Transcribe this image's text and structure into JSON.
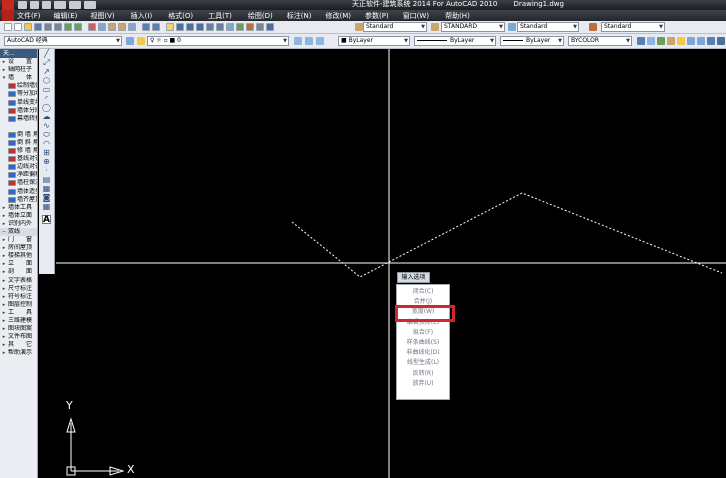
{
  "title_bar": {
    "title": "天正软件-建筑系统 2014  For AutoCAD 2010",
    "document": "Drawing1.dwg"
  },
  "menu_bar": {
    "items": [
      "文件(F)",
      "编辑(E)",
      "视图(V)",
      "插入(I)",
      "格式(O)",
      "工具(T)",
      "绘图(D)",
      "标注(N)",
      "修改(M)",
      "参数(P)",
      "窗口(W)",
      "帮助(H)"
    ]
  },
  "toolbar1": {
    "text_style": "Standard",
    "dim_style": "STANDARD",
    "table_style": "Standard",
    "multileader_style": "Standard"
  },
  "toolbar2": {
    "workspace": "AutoCAD 经典",
    "layer": "0",
    "color": "ByLayer",
    "linetype": "ByLayer",
    "lineweight": "ByLayer",
    "plot_style": "BYCOLOR"
  },
  "palette": {
    "title": "天...",
    "items": [
      {
        "marker": "▸",
        "label": "设　　置",
        "color": "#ffffff"
      },
      {
        "marker": "▸",
        "label": "轴网柱子",
        "color": "#ffffff"
      },
      {
        "marker": "▾",
        "label": "墙　　体",
        "color": "#ffffff"
      },
      {
        "marker": "",
        "label": "绘制墙体",
        "color": "#c62f2f"
      },
      {
        "marker": "",
        "label": "等分加墙",
        "color": "#2f6ac6"
      },
      {
        "marker": "",
        "label": "单线变墙",
        "color": "#2f6ac6"
      },
      {
        "marker": "",
        "label": "墙体分段",
        "color": "#c62f2f"
      },
      {
        "marker": "",
        "label": "幕墙转换",
        "color": "#2f6ac6"
      },
      {
        "marker": "",
        "label": "",
        "color": "#ffffff"
      },
      {
        "marker": "",
        "label": "倒 墙 角",
        "color": "#2f6ac6"
      },
      {
        "marker": "",
        "label": "倒 斜 角",
        "color": "#2f6ac6"
      },
      {
        "marker": "",
        "label": "修 墙 角",
        "color": "#c62f2f"
      },
      {
        "marker": "",
        "label": "基线对齐",
        "color": "#c62f2f"
      },
      {
        "marker": "",
        "label": "边线对齐",
        "color": "#2f6ac6"
      },
      {
        "marker": "",
        "label": "净距偏移",
        "color": "#2f6ac6"
      },
      {
        "marker": "",
        "label": "墙柱保温",
        "color": "#c62f2f"
      },
      {
        "marker": "",
        "label": "墙体造型",
        "color": "#2f6ac6"
      },
      {
        "marker": "",
        "label": "墙齐屋顶",
        "color": "#2f6ac6"
      },
      {
        "marker": "▸",
        "label": "墙体工具",
        "color": "#ffffff"
      },
      {
        "marker": "▸",
        "label": "墙体立面",
        "color": "#ffffff"
      },
      {
        "marker": "▸",
        "label": "识别内外",
        "color": "#ffffff"
      },
      {
        "marker": "",
        "label": "",
        "color": "#ffffff"
      },
      {
        "marker": "▸",
        "label": "门　　窗",
        "color": "#ffffff"
      },
      {
        "marker": "▸",
        "label": "房间屋顶",
        "color": "#ffffff"
      },
      {
        "marker": "▸",
        "label": "楼梯其他",
        "color": "#ffffff"
      },
      {
        "marker": "▸",
        "label": "立　　面",
        "color": "#ffffff"
      },
      {
        "marker": "▸",
        "label": "剖　　面",
        "color": "#ffffff"
      },
      {
        "marker": "▸",
        "label": "文字表格",
        "color": "#ffffff"
      },
      {
        "marker": "▸",
        "label": "尺寸标注",
        "color": "#ffffff"
      },
      {
        "marker": "▸",
        "label": "符号标注",
        "color": "#ffffff"
      },
      {
        "marker": "▸",
        "label": "图层控制",
        "color": "#ffffff"
      },
      {
        "marker": "▸",
        "label": "工　　具",
        "color": "#ffffff"
      },
      {
        "marker": "▸",
        "label": "三维建模",
        "color": "#ffffff"
      },
      {
        "marker": "▸",
        "label": "图块图案",
        "color": "#ffffff"
      },
      {
        "marker": "▸",
        "label": "文件布图",
        "color": "#ffffff"
      },
      {
        "marker": "▸",
        "label": "其　　它",
        "color": "#ffffff"
      },
      {
        "marker": "▸",
        "label": "帮助演示",
        "color": "#ffffff"
      }
    ],
    "section2_title": "双线",
    "section2_marker": "─"
  },
  "draw_toolbar": {
    "icons": [
      "line-icon",
      "construction-line-icon",
      "polyline-icon",
      "polygon-icon",
      "rectangle-icon",
      "arc-icon",
      "circle-icon",
      "revision-cloud-icon",
      "spline-icon",
      "ellipse-icon",
      "ellipse-arc-icon",
      "insert-block-icon",
      "make-block-icon",
      "point-icon",
      "hatch-icon",
      "gradient-icon",
      "region-icon",
      "table-icon",
      "multiline-text-icon"
    ],
    "glyphs": [
      "╱",
      "⤢",
      "↗",
      "⬡",
      "▭",
      "◜",
      "◯",
      "☁",
      "∿",
      "⬭",
      "◠",
      "⊞",
      "⊕",
      "·",
      "▤",
      "▦",
      "◙",
      "▦",
      "A"
    ]
  },
  "context_menu": {
    "header": "输入选项",
    "items": [
      "闭合(C)",
      "合并(J)",
      "宽度(W)",
      "编辑顶点(E)",
      "拟合(F)",
      "样条曲线(S)",
      "非曲线化(D)",
      "线型生成(L)",
      "反转(R)",
      "放弃(U)"
    ],
    "highlighted_index": 2,
    "highlight_color": "#d1262f"
  },
  "ucs": {
    "x_label": "X",
    "y_label": "Y"
  },
  "colors": {
    "canvas": "#000000",
    "crosshair": "#ffffff",
    "polyline": "#ffffff"
  }
}
